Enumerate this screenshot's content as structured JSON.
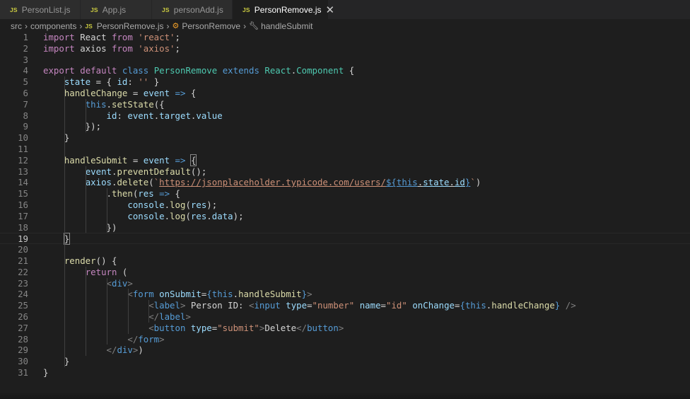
{
  "tabs": [
    {
      "icon": "JS",
      "label": "PersonList.js"
    },
    {
      "icon": "JS",
      "label": "App.js"
    },
    {
      "icon": "JS",
      "label": "personAdd.js"
    },
    {
      "icon": "JS",
      "label": "PersonRemove.js",
      "active": true,
      "close": "✕"
    }
  ],
  "breadcrumb": {
    "src": "src",
    "components": "components",
    "file": "PersonRemove.js",
    "class": "PersonRemove",
    "method": "handleSubmit"
  },
  "line_numbers": [
    "1",
    "2",
    "3",
    "4",
    "5",
    "6",
    "7",
    "8",
    "9",
    "10",
    "11",
    "12",
    "13",
    "14",
    "15",
    "16",
    "17",
    "18",
    "19",
    "20",
    "21",
    "22",
    "23",
    "24",
    "25",
    "26",
    "27",
    "28",
    "29",
    "30",
    "31"
  ],
  "code_lines": [
    [
      [
        "k",
        "import"
      ],
      [
        "p",
        " React "
      ],
      [
        "k",
        "from"
      ],
      [
        "p",
        " "
      ],
      [
        "s",
        "'react'"
      ],
      [
        "p",
        ";"
      ]
    ],
    [
      [
        "k",
        "import"
      ],
      [
        "p",
        " axios "
      ],
      [
        "k",
        "from"
      ],
      [
        "p",
        " "
      ],
      [
        "s",
        "'axios'"
      ],
      [
        "p",
        ";"
      ]
    ],
    [],
    [
      [
        "k",
        "export"
      ],
      [
        "p",
        " "
      ],
      [
        "k",
        "default"
      ],
      [
        "p",
        " "
      ],
      [
        "b",
        "class"
      ],
      [
        "p",
        " "
      ],
      [
        "t",
        "PersonRemove"
      ],
      [
        "p",
        " "
      ],
      [
        "b",
        "extends"
      ],
      [
        "p",
        " "
      ],
      [
        "t",
        "React"
      ],
      [
        "p",
        "."
      ],
      [
        "t",
        "Component"
      ],
      [
        "p",
        " {"
      ]
    ],
    [
      [
        "p",
        "    "
      ],
      [
        "v",
        "state"
      ],
      [
        "p",
        " = { "
      ],
      [
        "v",
        "id"
      ],
      [
        "p",
        ": "
      ],
      [
        "s",
        "''"
      ],
      [
        "p",
        " }"
      ]
    ],
    [
      [
        "p",
        "    "
      ],
      [
        "f",
        "handleChange"
      ],
      [
        "p",
        " = "
      ],
      [
        "v",
        "event"
      ],
      [
        "p",
        " "
      ],
      [
        "b",
        "=>"
      ],
      [
        "p",
        " {"
      ]
    ],
    [
      [
        "p",
        "        "
      ],
      [
        "b",
        "this"
      ],
      [
        "p",
        "."
      ],
      [
        "f",
        "setState"
      ],
      [
        "p",
        "({"
      ]
    ],
    [
      [
        "p",
        "            "
      ],
      [
        "v",
        "id"
      ],
      [
        "p",
        ": "
      ],
      [
        "v",
        "event"
      ],
      [
        "p",
        "."
      ],
      [
        "v",
        "target"
      ],
      [
        "p",
        "."
      ],
      [
        "v",
        "value"
      ]
    ],
    [
      [
        "p",
        "        });"
      ]
    ],
    [
      [
        "p",
        "    }"
      ]
    ],
    [],
    [
      [
        "p",
        "    "
      ],
      [
        "f",
        "handleSubmit"
      ],
      [
        "p",
        " = "
      ],
      [
        "v",
        "event"
      ],
      [
        "p",
        " "
      ],
      [
        "b",
        "=>"
      ],
      [
        "p",
        " "
      ],
      [
        "bm",
        "{"
      ]
    ],
    [
      [
        "p",
        "        "
      ],
      [
        "v",
        "event"
      ],
      [
        "p",
        "."
      ],
      [
        "f",
        "preventDefault"
      ],
      [
        "p",
        "();"
      ]
    ],
    [
      [
        "p",
        "        "
      ],
      [
        "v",
        "axios"
      ],
      [
        "p",
        "."
      ],
      [
        "f",
        "delete"
      ],
      [
        "p",
        "("
      ],
      [
        "s",
        "`"
      ],
      [
        "su",
        "https://jsonplaceholder.typicode.com/users/"
      ],
      [
        "bu",
        "${"
      ],
      [
        "bu2",
        "this"
      ],
      [
        "pu",
        "."
      ],
      [
        "vu",
        "state"
      ],
      [
        "pu",
        "."
      ],
      [
        "vu",
        "id"
      ],
      [
        "bu",
        "}"
      ],
      [
        "s",
        "`"
      ],
      [
        "p",
        ")"
      ]
    ],
    [
      [
        "p",
        "            ."
      ],
      [
        "f",
        "then"
      ],
      [
        "p",
        "("
      ],
      [
        "v",
        "res"
      ],
      [
        "p",
        " "
      ],
      [
        "b",
        "=>"
      ],
      [
        "p",
        " {"
      ]
    ],
    [
      [
        "p",
        "                "
      ],
      [
        "v",
        "console"
      ],
      [
        "p",
        "."
      ],
      [
        "f",
        "log"
      ],
      [
        "p",
        "("
      ],
      [
        "v",
        "res"
      ],
      [
        "p",
        ");"
      ]
    ],
    [
      [
        "p",
        "                "
      ],
      [
        "v",
        "console"
      ],
      [
        "p",
        "."
      ],
      [
        "f",
        "log"
      ],
      [
        "p",
        "("
      ],
      [
        "v",
        "res"
      ],
      [
        "p",
        "."
      ],
      [
        "v",
        "data"
      ],
      [
        "p",
        ");"
      ]
    ],
    [
      [
        "p",
        "            })"
      ]
    ],
    [
      [
        "p",
        "    "
      ],
      [
        "bm",
        "}"
      ]
    ],
    [],
    [
      [
        "p",
        "    "
      ],
      [
        "f",
        "render"
      ],
      [
        "p",
        "() {"
      ]
    ],
    [
      [
        "p",
        "        "
      ],
      [
        "k",
        "return"
      ],
      [
        "p",
        " ("
      ]
    ],
    [
      [
        "p",
        "            "
      ],
      [
        "g",
        "<"
      ],
      [
        "b",
        "div"
      ],
      [
        "g",
        ">"
      ]
    ],
    [
      [
        "p",
        "                "
      ],
      [
        "g",
        "<"
      ],
      [
        "b",
        "form"
      ],
      [
        "p",
        " "
      ],
      [
        "v",
        "onSubmit"
      ],
      [
        "p",
        "="
      ],
      [
        "b",
        "{this"
      ],
      [
        "p",
        "."
      ],
      [
        "f",
        "handleSubmit"
      ],
      [
        "b",
        "}"
      ],
      [
        "g",
        ">"
      ]
    ],
    [
      [
        "p",
        "                    "
      ],
      [
        "g",
        "<"
      ],
      [
        "b",
        "label"
      ],
      [
        "g",
        ">"
      ],
      [
        "p",
        " Person ID: "
      ],
      [
        "g",
        "<"
      ],
      [
        "b",
        "input"
      ],
      [
        "p",
        " "
      ],
      [
        "v",
        "type"
      ],
      [
        "p",
        "="
      ],
      [
        "s",
        "\"number\""
      ],
      [
        "p",
        " "
      ],
      [
        "v",
        "name"
      ],
      [
        "p",
        "="
      ],
      [
        "s",
        "\"id\""
      ],
      [
        "p",
        " "
      ],
      [
        "v",
        "onChange"
      ],
      [
        "p",
        "="
      ],
      [
        "b",
        "{this"
      ],
      [
        "p",
        "."
      ],
      [
        "f",
        "handleChange"
      ],
      [
        "b",
        "}"
      ],
      [
        "p",
        " "
      ],
      [
        "g",
        "/>"
      ]
    ],
    [
      [
        "p",
        "                    "
      ],
      [
        "g",
        "</"
      ],
      [
        "b",
        "label"
      ],
      [
        "g",
        ">"
      ]
    ],
    [
      [
        "p",
        "                    "
      ],
      [
        "g",
        "<"
      ],
      [
        "b",
        "button"
      ],
      [
        "p",
        " "
      ],
      [
        "v",
        "type"
      ],
      [
        "p",
        "="
      ],
      [
        "s",
        "\"submit\""
      ],
      [
        "g",
        ">"
      ],
      [
        "p",
        "Delete"
      ],
      [
        "g",
        "</"
      ],
      [
        "b",
        "button"
      ],
      [
        "g",
        ">"
      ]
    ],
    [
      [
        "p",
        "                "
      ],
      [
        "g",
        "</"
      ],
      [
        "b",
        "form"
      ],
      [
        "g",
        ">"
      ]
    ],
    [
      [
        "p",
        "            "
      ],
      [
        "g",
        "</"
      ],
      [
        "b",
        "div"
      ],
      [
        "g",
        ">"
      ],
      [
        "p",
        ")"
      ]
    ],
    [
      [
        "p",
        "    }"
      ]
    ],
    [
      [
        "p",
        "}"
      ]
    ]
  ],
  "current_line": "19",
  "colors": {
    "keyword": "#c586c0",
    "string": "#ce9178",
    "blue": "#569cd6",
    "type": "#4ec9b0",
    "variable": "#9cdcfe",
    "function": "#dcdcaa",
    "plain": "#d4d4d4",
    "tag_bracket": "#808080",
    "js_icon": "#cbcb41"
  }
}
